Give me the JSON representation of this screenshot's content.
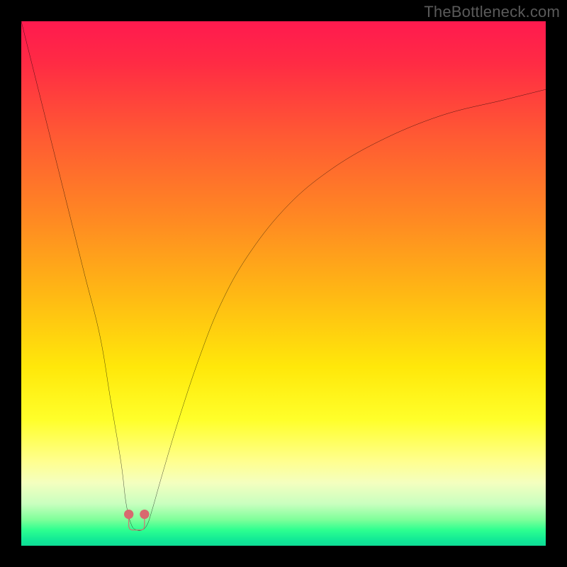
{
  "watermark": {
    "text": "TheBottleneck.com"
  },
  "colors": {
    "curve": "#000000",
    "marker_stroke": "#d86a6f",
    "marker_fill": "#d86a6f",
    "frame": "#000000"
  },
  "chart_data": {
    "type": "line",
    "title": "",
    "xlabel": "",
    "ylabel": "",
    "xlim": [
      0,
      100
    ],
    "ylim": [
      0,
      100
    ],
    "grid": false,
    "series": [
      {
        "name": "bottleneck-curve",
        "x": [
          0,
          3,
          6,
          9,
          12,
          15,
          17,
          19,
          20,
          21,
          22,
          23,
          24,
          25,
          27,
          30,
          34,
          38,
          43,
          50,
          58,
          68,
          80,
          92,
          100
        ],
        "y": [
          100,
          88,
          76,
          64,
          52,
          40,
          28,
          16,
          8,
          4,
          3,
          3,
          4,
          7,
          14,
          24,
          36,
          46,
          55,
          64,
          71,
          77,
          82,
          85,
          87
        ]
      }
    ],
    "annotations": [
      {
        "name": "u-marker",
        "shape": "U",
        "x_range": [
          20.5,
          23.5
        ],
        "y_range": [
          3,
          6
        ]
      }
    ]
  }
}
